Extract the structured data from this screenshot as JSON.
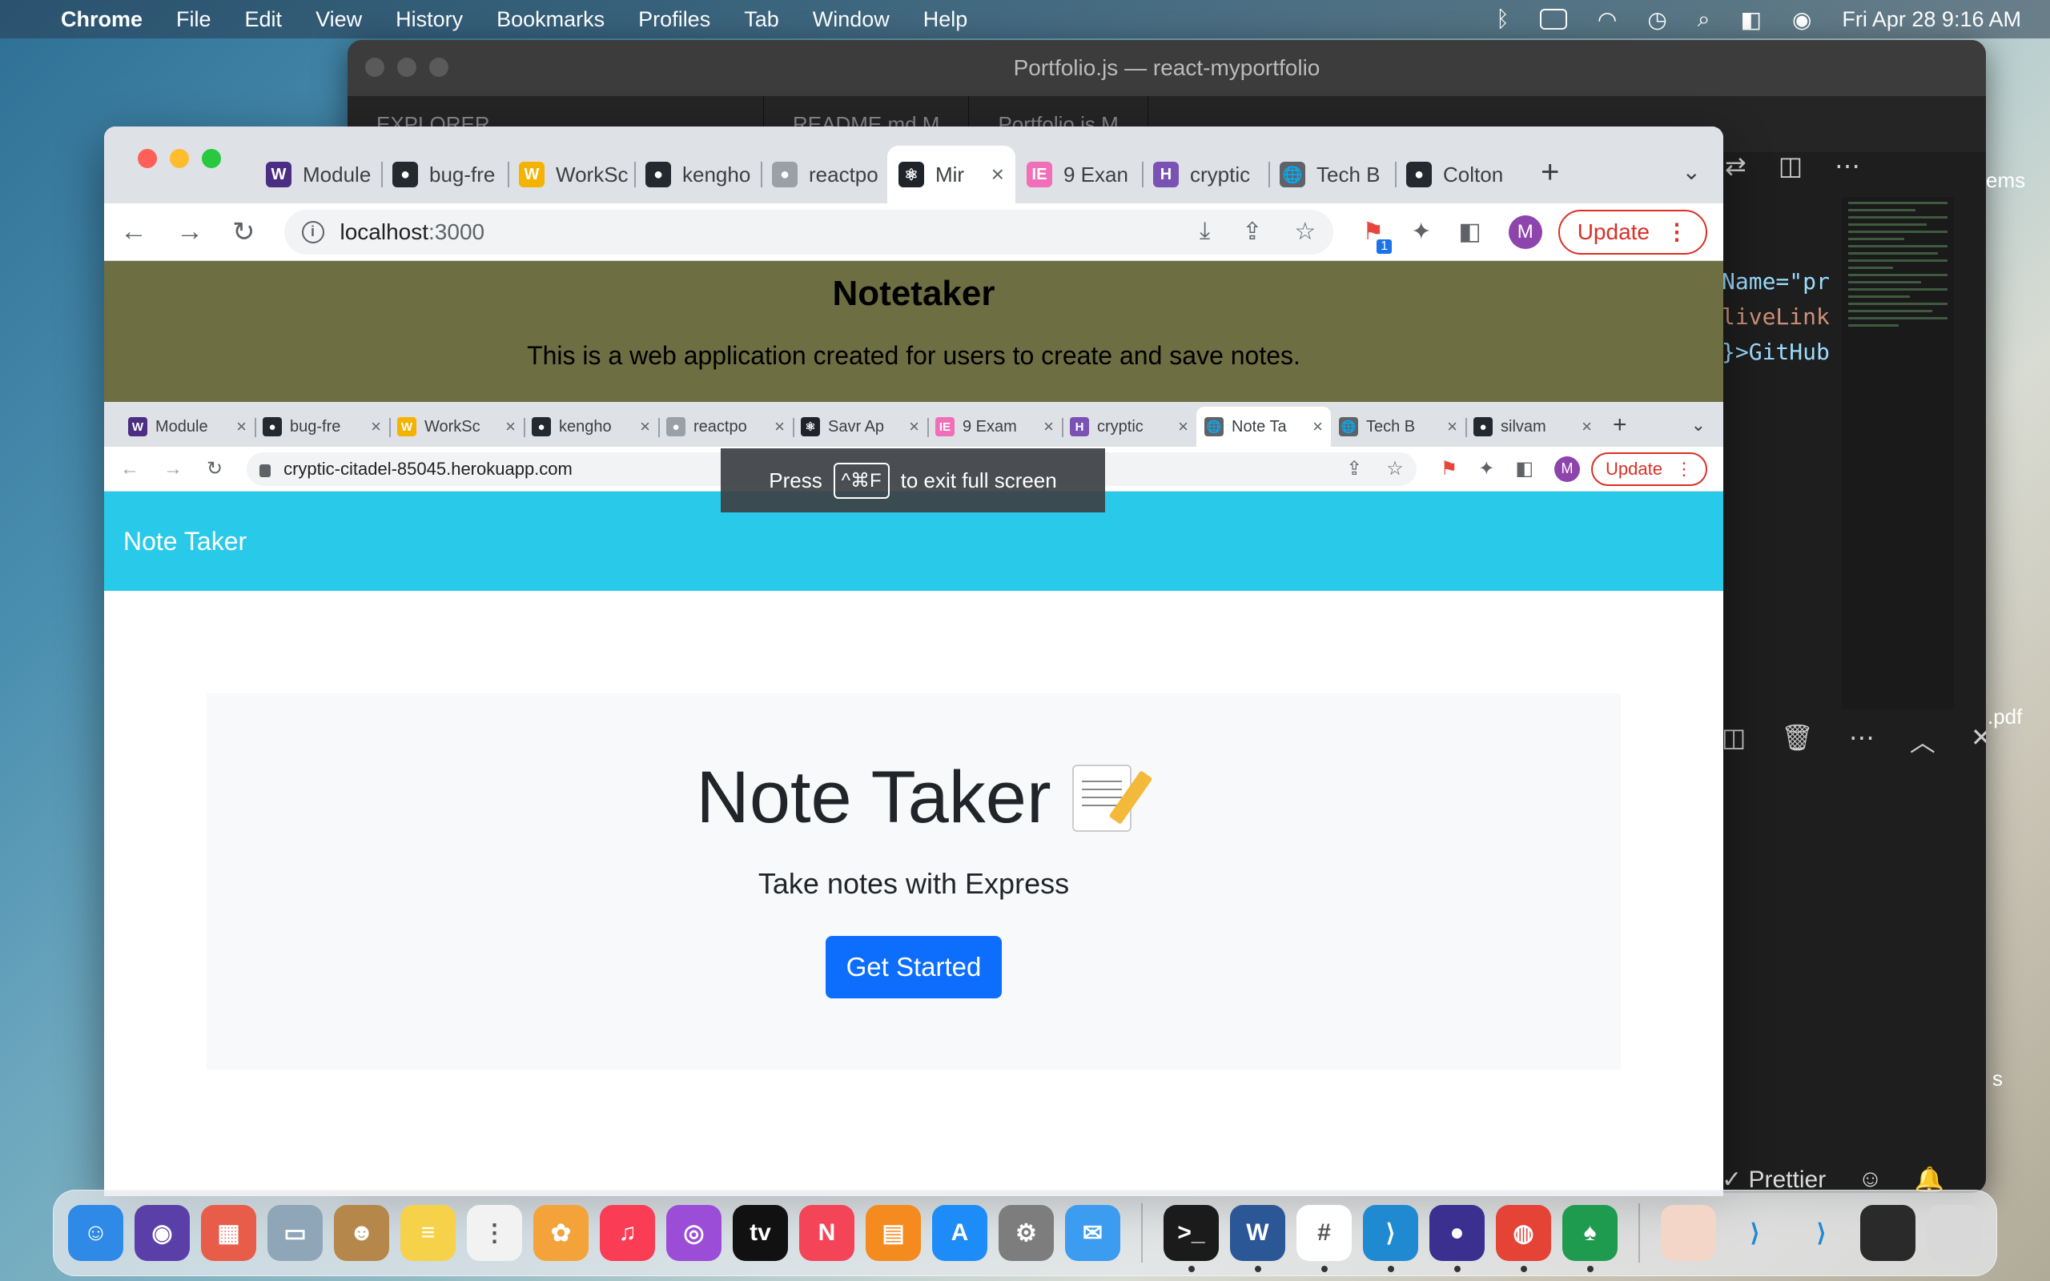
{
  "menubar": {
    "app": "Chrome",
    "items": [
      "File",
      "Edit",
      "View",
      "History",
      "Bookmarks",
      "Profiles",
      "Tab",
      "Window",
      "Help"
    ],
    "datetime": "Fri Apr 28  9:16 AM"
  },
  "vscode": {
    "title": "Portfolio.js — react-myportfolio",
    "tabs": [
      "EXPLORER",
      "README.md M",
      "Portfolio.js M"
    ],
    "code_lines": [
      "Name=\"pr",
      "liveLink",
      "}>GitHub"
    ],
    "status_prettier": "Prettier",
    "desktop_labels": [
      "ems",
      ".pdf",
      "s"
    ]
  },
  "chrome": {
    "tabs": [
      {
        "label": "Module",
        "fav": "W",
        "color": "#4b2e83"
      },
      {
        "label": "bug-fre",
        "fav": "gh",
        "color": "#24292f"
      },
      {
        "label": "WorkSc",
        "fav": "W",
        "color": "#f5b301"
      },
      {
        "label": "kengho",
        "fav": "gh",
        "color": "#24292f"
      },
      {
        "label": "reactpo",
        "fav": "gh",
        "color": "#9aa0a6"
      },
      {
        "label": "Mir",
        "fav": "⚛",
        "color": "#20232a"
      },
      {
        "label": "9 Exan",
        "fav": "IE",
        "color": "#f06fb8"
      },
      {
        "label": "cryptic",
        "fav": "H",
        "color": "#7952b3"
      },
      {
        "label": "Tech B",
        "fav": "🌐",
        "color": "#5f6368"
      },
      {
        "label": "Colton",
        "fav": "gh",
        "color": "#24292f"
      }
    ],
    "active_tab_index": 5,
    "url_host": "localhost",
    "url_port": ":3000",
    "update_label": "Update",
    "avatar_letter": "M",
    "extension_badge": "1"
  },
  "page": {
    "title": "Notetaker",
    "description": "This is a web application created for users to create and save notes."
  },
  "inner_browser": {
    "tabs": [
      {
        "label": "Module",
        "fav": "W",
        "color": "#4b2e83"
      },
      {
        "label": "bug-fre",
        "fav": "gh",
        "color": "#24292f"
      },
      {
        "label": "WorkSc",
        "fav": "W",
        "color": "#f5b301"
      },
      {
        "label": "kengho",
        "fav": "gh",
        "color": "#24292f"
      },
      {
        "label": "reactpo",
        "fav": "gh",
        "color": "#9aa0a6"
      },
      {
        "label": "Savr Ap",
        "fav": "⚛",
        "color": "#20232a"
      },
      {
        "label": "9 Exam",
        "fav": "IE",
        "color": "#f06fb8"
      },
      {
        "label": "cryptic",
        "fav": "H",
        "color": "#7952b3"
      },
      {
        "label": "Note Ta",
        "fav": "🌐",
        "color": "#5f6368"
      },
      {
        "label": "Tech B",
        "fav": "🌐",
        "color": "#5f6368"
      },
      {
        "label": "silvam",
        "fav": "gh",
        "color": "#24292f"
      }
    ],
    "active_tab_index": 8,
    "url": "cryptic-citadel-85045.herokuapp.com",
    "update_label": "Update",
    "avatar_letter": "M",
    "fullscreen_press": "Press",
    "fullscreen_keys": "^⌘F",
    "fullscreen_suffix": "to exit full screen"
  },
  "app": {
    "brand": "Note Taker",
    "heading": "Note Taker",
    "lead": "Take notes with Express",
    "cta": "Get Started"
  },
  "dock": {
    "apps": [
      {
        "name": "finder",
        "glyph": "☺",
        "color": "#2e8ae6"
      },
      {
        "name": "siri",
        "glyph": "◉",
        "color": "#5b3fa8"
      },
      {
        "name": "launchpad",
        "glyph": "▦",
        "color": "#e85d4a"
      },
      {
        "name": "preview",
        "glyph": "▭",
        "color": "#8fa6b8"
      },
      {
        "name": "contacts",
        "glyph": "☻",
        "color": "#b5874a"
      },
      {
        "name": "notes",
        "glyph": "≡",
        "color": "#f6d24a"
      },
      {
        "name": "reminders",
        "glyph": "⋮",
        "color": "#f2f2f2"
      },
      {
        "name": "photos",
        "glyph": "✿",
        "color": "#f3a33a"
      },
      {
        "name": "music",
        "glyph": "♫",
        "color": "#fa3d55"
      },
      {
        "name": "podcasts",
        "glyph": "◎",
        "color": "#9b4dd8"
      },
      {
        "name": "tv",
        "glyph": "tv",
        "color": "#111111"
      },
      {
        "name": "news",
        "glyph": "N",
        "color": "#f44458"
      },
      {
        "name": "books",
        "glyph": "▤",
        "color": "#f58a1f"
      },
      {
        "name": "app-store",
        "glyph": "A",
        "color": "#1d8cf8"
      },
      {
        "name": "system-preferences",
        "glyph": "⚙",
        "color": "#7d7d7d"
      },
      {
        "name": "mail",
        "glyph": "✉",
        "color": "#3b9cf0"
      },
      {
        "name": "terminal",
        "glyph": ">_",
        "color": "#1b1b1b"
      },
      {
        "name": "word",
        "glyph": "W",
        "color": "#2b5797"
      },
      {
        "name": "slack",
        "glyph": "#",
        "color": "#ffffff"
      },
      {
        "name": "vscode",
        "glyph": "⟩",
        "color": "#1f8ad2"
      },
      {
        "name": "nightowl",
        "glyph": "●",
        "color": "#3b2f8f"
      },
      {
        "name": "chrome",
        "glyph": "◍",
        "color": "#e54335"
      },
      {
        "name": "mongodb",
        "glyph": "♠",
        "color": "#1f9b4f"
      }
    ]
  }
}
